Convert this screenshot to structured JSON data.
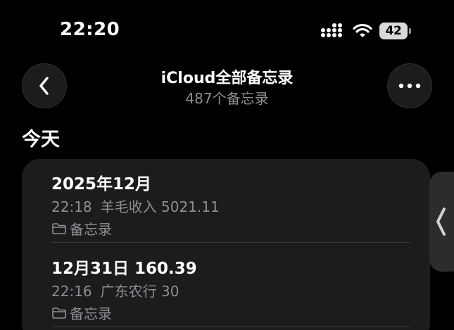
{
  "status_bar": {
    "time": "22:20",
    "battery_level": "42",
    "icons": [
      "cellular-signal-icon",
      "wifi-icon",
      "battery-icon"
    ]
  },
  "nav": {
    "back_icon": "chevron-left-icon",
    "more_icon": "ellipsis-icon",
    "title": "iCloud全部备忘录",
    "subtitle": "487个备忘录"
  },
  "section": {
    "header": "今天"
  },
  "notes": [
    {
      "title": "2025年12月",
      "time": "22:18",
      "preview": "羊毛收入 5021.11",
      "folder": "备忘录"
    },
    {
      "title": "12月31日 160.39",
      "time": "22:16",
      "preview": "广东农行 30",
      "folder": "备忘录"
    }
  ],
  "side_handle": {
    "icon": "chevron-left-icon"
  },
  "colors": {
    "background": "#000000",
    "card": "#1c1c1e",
    "secondary_text": "#8e8e93",
    "separator": "#3a3a3c"
  }
}
